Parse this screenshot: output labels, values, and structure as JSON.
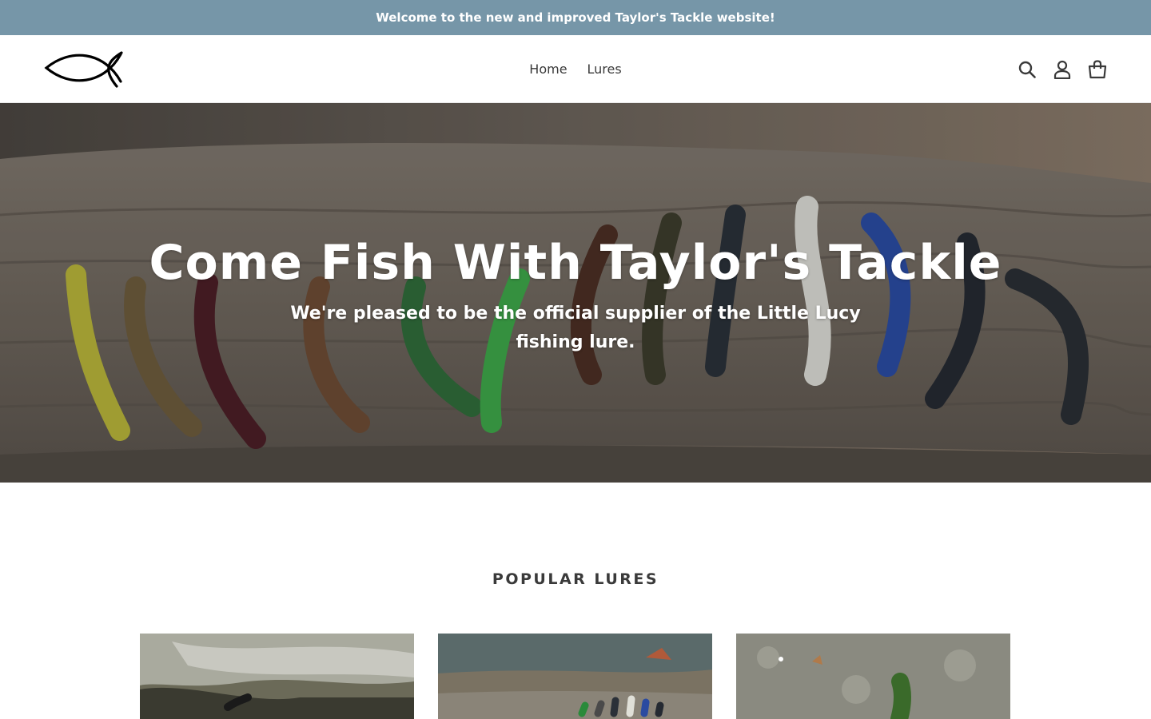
{
  "announcement": {
    "text": "Welcome to the new and improved Taylor's Tackle website!"
  },
  "header": {
    "logo_icon": "fish-logo-icon",
    "nav": [
      {
        "label": "Home"
      },
      {
        "label": "Lures"
      }
    ],
    "icons": [
      "search-icon",
      "account-icon",
      "cart-icon"
    ]
  },
  "hero": {
    "title": "Come Fish With Taylor's Tackle",
    "subtitle": "We're pleased to be the official supplier of the Little Lucy fishing lure."
  },
  "featured": {
    "title": "POPULAR LURES",
    "products": [
      {
        "image": "lure-on-rock-by-water"
      },
      {
        "image": "lures-on-log-by-stream"
      },
      {
        "image": "green-lure-on-stone"
      }
    ]
  },
  "colors": {
    "announcement_bg": "#7696a8",
    "text": "#3a3a3a"
  }
}
